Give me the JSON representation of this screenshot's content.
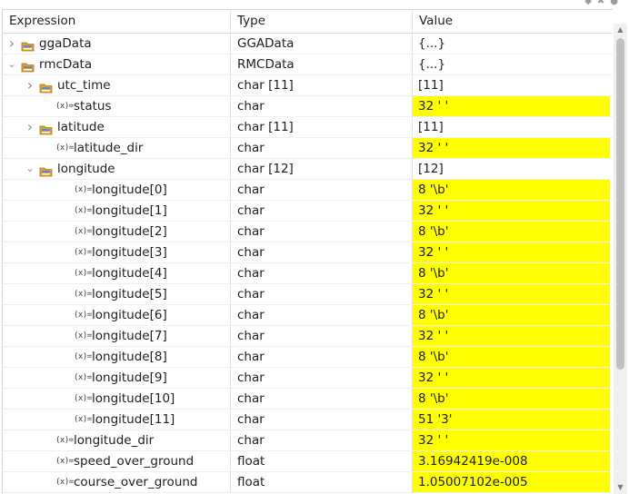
{
  "header": {
    "expression": "Expression",
    "type": "Type",
    "value": "Value"
  },
  "colors": {
    "highlight": "#ffff00",
    "struct_icon": "#e0a030"
  },
  "rows": [
    {
      "depth": 0,
      "expander": "collapsed",
      "icon": "struct-icon",
      "expression": "ggaData",
      "type": "GGAData",
      "value": "{...}",
      "highlight": false
    },
    {
      "depth": 0,
      "expander": "expanded",
      "icon": "struct-icon",
      "expression": "rmcData",
      "type": "RMCData",
      "value": "{...}",
      "highlight": false
    },
    {
      "depth": 1,
      "expander": "collapsed",
      "icon": "array-icon",
      "expression": "utc_time",
      "type": "char [11]",
      "value": "[11]",
      "highlight": false
    },
    {
      "depth": 1,
      "expander": "none",
      "icon": "variable-icon",
      "expression": "status",
      "type": "char",
      "value": "32 ' '",
      "highlight": true
    },
    {
      "depth": 1,
      "expander": "collapsed",
      "icon": "array-icon",
      "expression": "latitude",
      "type": "char [11]",
      "value": "[11]",
      "highlight": false
    },
    {
      "depth": 1,
      "expander": "none",
      "icon": "variable-icon",
      "expression": "latitude_dir",
      "type": "char",
      "value": "32 ' '",
      "highlight": true
    },
    {
      "depth": 1,
      "expander": "expanded",
      "icon": "array-icon",
      "expression": "longitude",
      "type": "char [12]",
      "value": "[12]",
      "highlight": false
    },
    {
      "depth": 2,
      "expander": "none",
      "icon": "variable-icon",
      "expression": "longitude[0]",
      "type": "char",
      "value": "8 '\\b'",
      "highlight": true
    },
    {
      "depth": 2,
      "expander": "none",
      "icon": "variable-icon",
      "expression": "longitude[1]",
      "type": "char",
      "value": "32 ' '",
      "highlight": true
    },
    {
      "depth": 2,
      "expander": "none",
      "icon": "variable-icon",
      "expression": "longitude[2]",
      "type": "char",
      "value": "8 '\\b'",
      "highlight": true
    },
    {
      "depth": 2,
      "expander": "none",
      "icon": "variable-icon",
      "expression": "longitude[3]",
      "type": "char",
      "value": "32 ' '",
      "highlight": true
    },
    {
      "depth": 2,
      "expander": "none",
      "icon": "variable-icon",
      "expression": "longitude[4]",
      "type": "char",
      "value": "8 '\\b'",
      "highlight": true
    },
    {
      "depth": 2,
      "expander": "none",
      "icon": "variable-icon",
      "expression": "longitude[5]",
      "type": "char",
      "value": "32 ' '",
      "highlight": true
    },
    {
      "depth": 2,
      "expander": "none",
      "icon": "variable-icon",
      "expression": "longitude[6]",
      "type": "char",
      "value": "8 '\\b'",
      "highlight": true
    },
    {
      "depth": 2,
      "expander": "none",
      "icon": "variable-icon",
      "expression": "longitude[7]",
      "type": "char",
      "value": "32 ' '",
      "highlight": true
    },
    {
      "depth": 2,
      "expander": "none",
      "icon": "variable-icon",
      "expression": "longitude[8]",
      "type": "char",
      "value": "8 '\\b'",
      "highlight": true
    },
    {
      "depth": 2,
      "expander": "none",
      "icon": "variable-icon",
      "expression": "longitude[9]",
      "type": "char",
      "value": "32 ' '",
      "highlight": true
    },
    {
      "depth": 2,
      "expander": "none",
      "icon": "variable-icon",
      "expression": "longitude[10]",
      "type": "char",
      "value": "8 '\\b'",
      "highlight": true
    },
    {
      "depth": 2,
      "expander": "none",
      "icon": "variable-icon",
      "expression": "longitude[11]",
      "type": "char",
      "value": "51 '3'",
      "highlight": true
    },
    {
      "depth": 1,
      "expander": "none",
      "icon": "variable-icon",
      "expression": "longitude_dir",
      "type": "char",
      "value": "32 ' '",
      "highlight": true
    },
    {
      "depth": 1,
      "expander": "none",
      "icon": "variable-icon",
      "expression": "speed_over_ground",
      "type": "float",
      "value": "3.16942419e-008",
      "highlight": true
    },
    {
      "depth": 1,
      "expander": "none",
      "icon": "variable-icon",
      "expression": "course_over_ground",
      "type": "float",
      "value": "1.05007102e-005",
      "highlight": true
    }
  ]
}
